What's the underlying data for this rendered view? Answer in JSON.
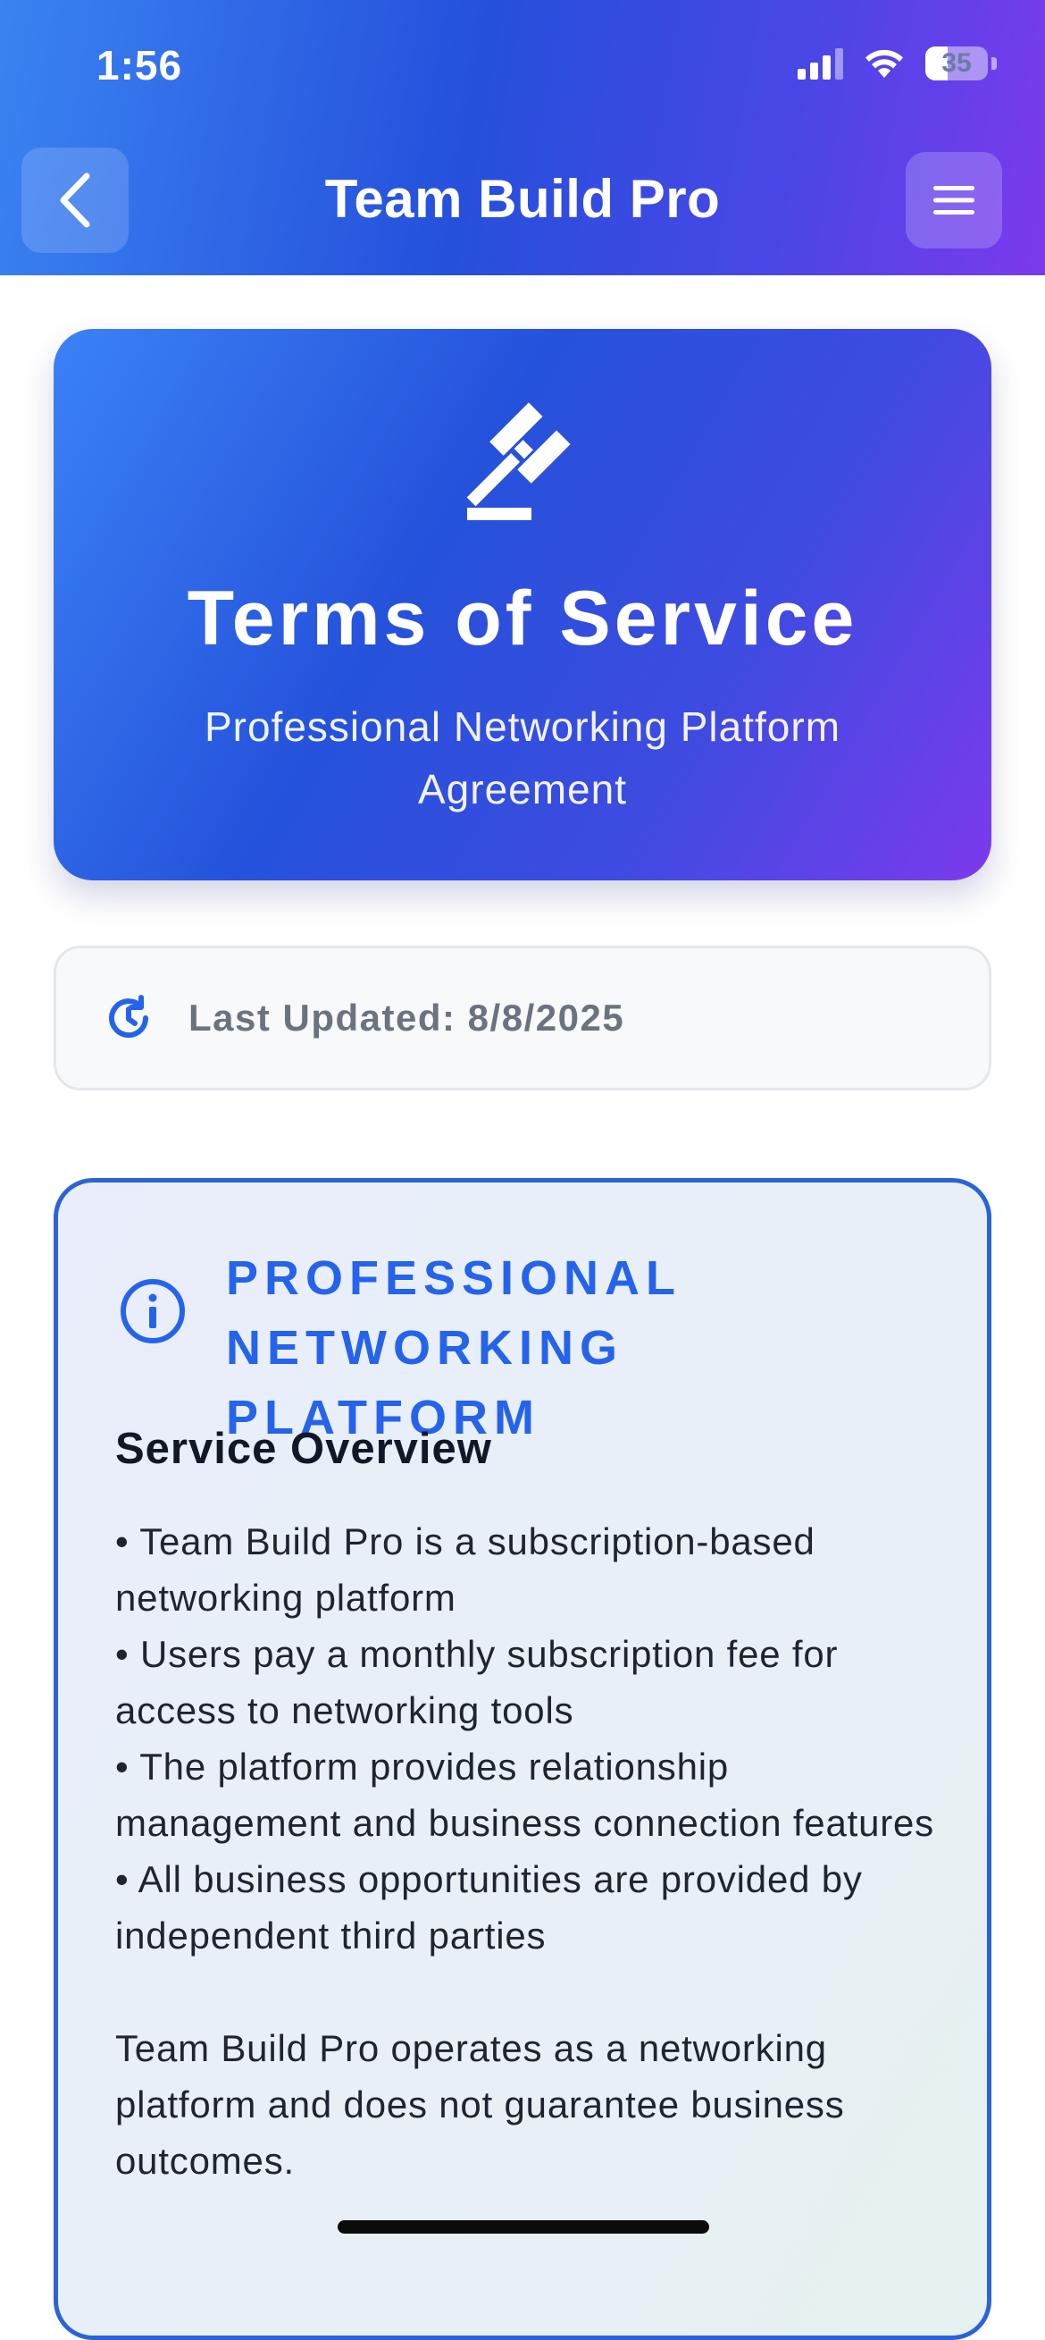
{
  "status_bar": {
    "time": "1:56",
    "battery": "35",
    "battery_level": 0.35
  },
  "header": {
    "title": "Team Build Pro",
    "back_icon": "chevron-left-icon",
    "menu_icon": "hamburger-menu-icon"
  },
  "hero": {
    "icon": "gavel-icon",
    "title": "Terms of Service",
    "subtitle": "Professional Networking Platform Agreement"
  },
  "updated": {
    "icon": "history-clock-icon",
    "text": "Last Updated: 8/8/2025"
  },
  "section": {
    "icon": "info-circle-icon",
    "title": "PROFESSIONAL NETWORKING PLATFORM",
    "heading": "Service Overview",
    "bullets": [
      "• Team Build Pro is a subscription-based networking platform",
      "• Users pay a monthly subscription fee for access to networking tools",
      "• The platform provides relationship management and business connection features",
      "• All business opportunities are provided by independent third parties"
    ],
    "paragraph": "Team Build Pro operates as a networking platform and does not guarantee business outcomes."
  },
  "colors": {
    "accent": "#2563eb",
    "header_start": "#3a83f2",
    "header_end": "#7c3aed"
  }
}
